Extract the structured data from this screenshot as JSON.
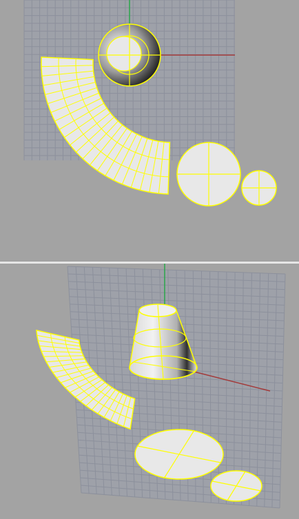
{
  "viewports": [
    {
      "view": "top",
      "grid": true,
      "axes": [
        "x",
        "y"
      ]
    },
    {
      "view": "perspective",
      "grid": true,
      "axes": [
        "x",
        "z"
      ]
    }
  ],
  "colors": {
    "background": "#a3a3a3",
    "grid_line": "#8f93a0",
    "grid_fill": "#9ea1a9",
    "selection_wire": "#ffff00",
    "surface": "#e8e8e8",
    "x_axis": "#a33a3a",
    "y_axis": "#2aa64a",
    "divider": "#e6e6e6"
  },
  "objects": [
    "cone",
    "arc-surface",
    "disk-large",
    "disk-small"
  ]
}
